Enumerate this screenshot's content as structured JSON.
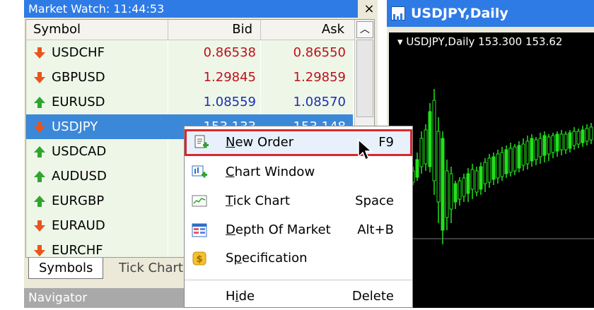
{
  "market_watch": {
    "title": "Market Watch: 11:44:53",
    "close_glyph": "×",
    "columns": {
      "symbol": "Symbol",
      "bid": "Bid",
      "ask": "Ask"
    },
    "rows": [
      {
        "symbol": "USDCHF",
        "bid": "0.86538",
        "ask": "0.86550",
        "direction": "down",
        "color": "#c0101a",
        "selected": false
      },
      {
        "symbol": "GBPUSD",
        "bid": "1.29845",
        "ask": "1.29859",
        "direction": "down",
        "color": "#c0101a",
        "selected": false
      },
      {
        "symbol": "EURUSD",
        "bid": "1.08559",
        "ask": "1.08570",
        "direction": "up",
        "color": "#1a2fb5",
        "selected": false
      },
      {
        "symbol": "USDJPY",
        "bid": "153.133",
        "ask": "153.148",
        "direction": "down",
        "color": "#ffffff",
        "selected": true
      },
      {
        "symbol": "USDCAD",
        "bid": "",
        "ask": "",
        "direction": "up",
        "color": "#1a2fb5",
        "selected": false
      },
      {
        "symbol": "AUDUSD",
        "bid": "",
        "ask": "",
        "direction": "up",
        "color": "#1a2fb5",
        "selected": false
      },
      {
        "symbol": "EURGBP",
        "bid": "",
        "ask": "",
        "direction": "up",
        "color": "#1a2fb5",
        "selected": false
      },
      {
        "symbol": "EURAUD",
        "bid": "",
        "ask": "",
        "direction": "down",
        "color": "#c0101a",
        "selected": false
      },
      {
        "symbol": "EURCHF",
        "bid": "",
        "ask": "",
        "direction": "down",
        "color": "#c0101a",
        "selected": false
      }
    ],
    "tabs": [
      "Symbols",
      "Tick Chart"
    ],
    "active_tab": "Symbols"
  },
  "navigator": {
    "title": "Navigator"
  },
  "chart_window": {
    "title": "USDJPY,Daily",
    "subtitle": "USDJPY,Daily  153.300 153.62",
    "icon": "chart-window-icon"
  },
  "context_menu": {
    "items": [
      {
        "label_pre": "",
        "label_u": "N",
        "label_post": "ew Order",
        "shortcut": "F9",
        "icon": "new-order-icon",
        "highlighted": true
      },
      {
        "label_pre": "",
        "label_u": "C",
        "label_post": "hart Window",
        "shortcut": "",
        "icon": "chart-window-icon",
        "highlighted": false
      },
      {
        "label_pre": "",
        "label_u": "T",
        "label_post": "ick Chart",
        "shortcut": "Space",
        "icon": "tick-chart-icon",
        "highlighted": false
      },
      {
        "label_pre": "",
        "label_u": "D",
        "label_post": "epth Of Market",
        "shortcut": "Alt+B",
        "icon": "depth-of-market-icon",
        "highlighted": false
      },
      {
        "label_pre": "S",
        "label_u": "p",
        "label_post": "ecification",
        "shortcut": "",
        "icon": "specification-icon",
        "highlighted": false
      },
      {
        "label_pre": "H",
        "label_u": "i",
        "label_post": "de",
        "shortcut": "Delete",
        "icon": "",
        "highlighted": false
      }
    ]
  },
  "colors": {
    "title_bar": "#2f7be6",
    "selection": "#3b88d8",
    "highlight_border": "#d9272e",
    "arrow_up": "#2fa52f",
    "arrow_down": "#e8551e",
    "candle": "#22e01c"
  }
}
